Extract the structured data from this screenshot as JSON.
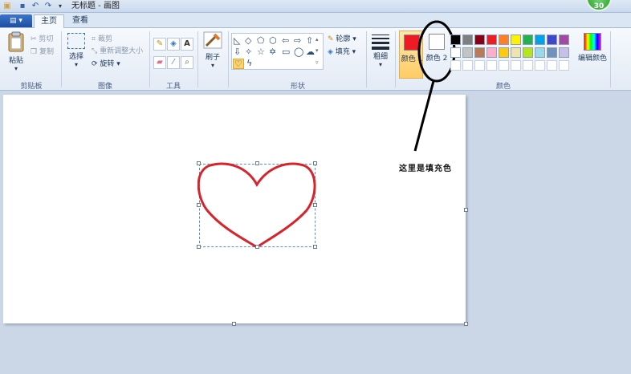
{
  "window": {
    "title": "无标题 - 画图",
    "badge": "30"
  },
  "tabs": [
    {
      "label": "主页"
    },
    {
      "label": "查看"
    }
  ],
  "clipboard": {
    "paste": "粘贴",
    "cut": "剪切",
    "copy": "复制",
    "group": "剪贴板"
  },
  "image": {
    "select": "选择",
    "crop": "裁剪",
    "resize": "重新调整大小",
    "rotate": "旋转",
    "group": "图像"
  },
  "tools": {
    "text_tool": "A",
    "group": "工具"
  },
  "brushes": {
    "label": "刷子"
  },
  "shapes": {
    "outline": "轮廓",
    "fill": "填充",
    "group": "形状"
  },
  "size": {
    "label": "粗细"
  },
  "colors": {
    "color1": "颜色 1",
    "color2": "颜色 2",
    "edit": "编辑颜色",
    "group": "颜色",
    "color1_value": "#ed1c24",
    "color2_value": "#ffffff",
    "palette_row1": [
      "#000000",
      "#7f7f7f",
      "#880015",
      "#ed1c24",
      "#ff7f27",
      "#fff200",
      "#22b14c",
      "#00a2e8",
      "#3f48cc",
      "#a349a4"
    ],
    "palette_row2": [
      "#ffffff",
      "#c3c3c3",
      "#b97a57",
      "#ffaec9",
      "#ffc90e",
      "#efe4b0",
      "#b5e61d",
      "#99d9ea",
      "#7092be",
      "#c8bfe7"
    ]
  },
  "annotation": {
    "text": "这里是填充色"
  },
  "drawing": {
    "shape": "heart",
    "stroke_color": "#d9232b"
  }
}
